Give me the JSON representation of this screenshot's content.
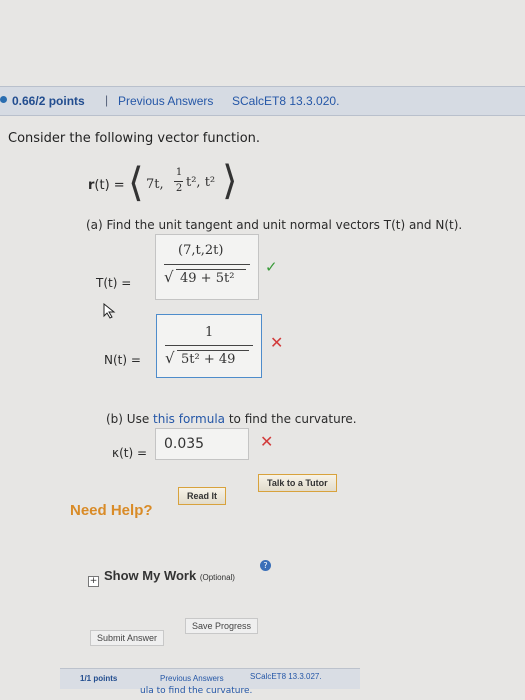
{
  "header": {
    "points": "0.66/2 points",
    "separator": "|",
    "previous_answers": "Previous Answers",
    "problem_code": "SCalcET8 13.3.020."
  },
  "problem": {
    "intro": "Consider the following vector function.",
    "r_label": "r",
    "r_arg": "(t) =",
    "r_comp1": "7t,",
    "r_comp2_num": "1",
    "r_comp2_den": "2",
    "r_comp2_rest": "t², t²",
    "part_a": "(a) Find the unit tangent and unit normal vectors T(t) and N(t).",
    "T_label": "T(t) =",
    "T_numer": "(7,t,2t)",
    "T_denom": "49 + 5t²",
    "N_label": "N(t) =",
    "N_numer": "1",
    "N_denom": "5t² + 49",
    "part_b_prefix": "(b) Use ",
    "part_b_link": "this formula",
    "part_b_suffix": " to find the curvature.",
    "kappa_label": "κ(t) =",
    "kappa_value": "0.035"
  },
  "help": {
    "need_help": "Need Help?",
    "read_it": "Read It",
    "talk_tutor": "Talk to a Tutor"
  },
  "work": {
    "show_my_work": "Show My Work",
    "optional": "(Optional)"
  },
  "actions": {
    "submit_answer": "Submit Answer",
    "save_progress": "Save Progress"
  },
  "next": {
    "points": "1/1 points",
    "previous_answers": "Previous Answers",
    "problem_code": "SCalcET8 13.3.027.",
    "snippet": "ula to find the curvature."
  },
  "colors": {
    "correct": "#3a9b3a",
    "incorrect": "#d23b3b",
    "link": "#2557a7",
    "help": "#d98b27"
  }
}
